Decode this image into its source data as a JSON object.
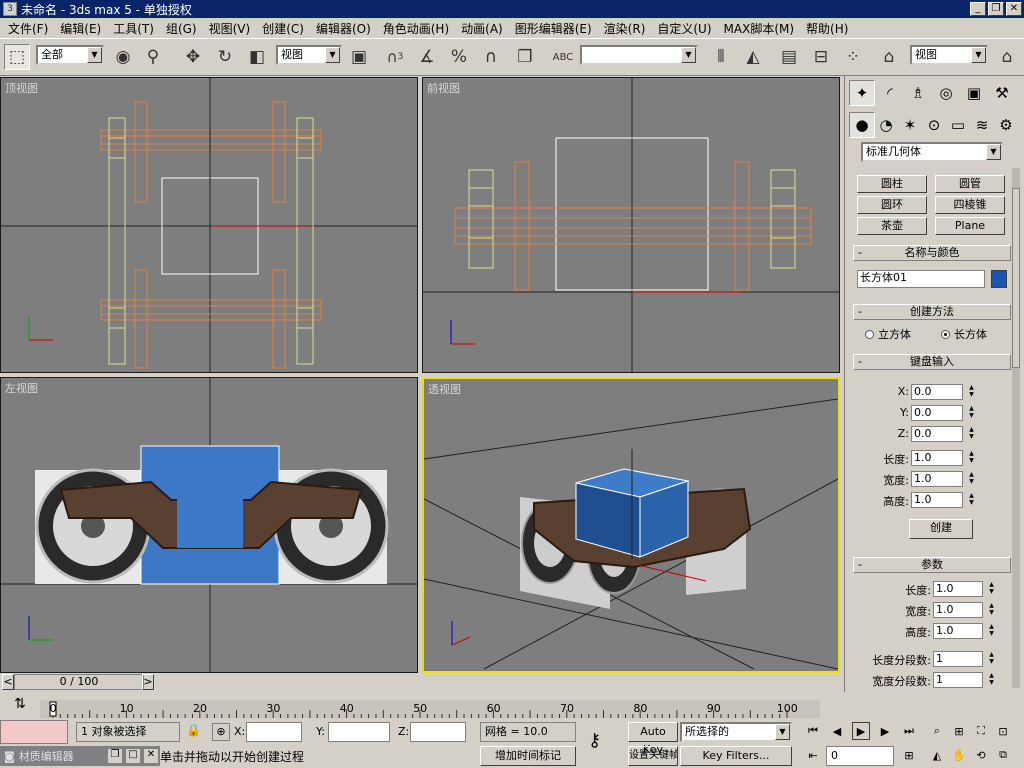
{
  "titlebar": {
    "icon": "3ds-max-icon",
    "title": "未命名 - 3ds max 5 - 单独授权",
    "minimize": "_",
    "restore": "❐",
    "close": "✕"
  },
  "menu": [
    "文件(F)",
    "编辑(E)",
    "工具(T)",
    "组(G)",
    "视图(V)",
    "创建(C)",
    "编辑器(O)",
    "角色动画(H)",
    "动画(A)",
    "图形编辑器(E)",
    "渲染(R)",
    "自定义(U)",
    "MAX脚本(M)",
    "帮助(H)"
  ],
  "toolbar": {
    "selection_filter": "全部",
    "coord_system": "视图",
    "named_selection": "",
    "view_dropdown_right": "视图",
    "selection_count_icon": "3"
  },
  "viewports": {
    "top": "顶视图",
    "front": "前视图",
    "left": "左视图",
    "perspective": "透视图"
  },
  "command_panel": {
    "category_dropdown": "标准几何体",
    "object_buttons": [
      "圆柱",
      "圆管",
      "圆环",
      "四棱锥",
      "茶壶",
      "Plane"
    ],
    "name_color": {
      "header": "名称与颜色",
      "name": "长方体01",
      "color": "#1c55b0"
    },
    "creation_method": {
      "header": "创建方法",
      "options": [
        "立方体",
        "长方体"
      ],
      "selected": "长方体"
    },
    "keyboard_entry": {
      "header": "键盘输入",
      "x_label": "X:",
      "x": "0.0",
      "y_label": "Y:",
      "y": "0.0",
      "z_label": "Z:",
      "z": "0.0",
      "length_label": "长度:",
      "length": "1.0",
      "width_label": "宽度:",
      "width": "1.0",
      "height_label": "高度:",
      "height": "1.0",
      "create_button": "创建"
    },
    "parameters": {
      "header": "参数",
      "length_label": "长度:",
      "length": "1.0",
      "width_label": "宽度:",
      "width": "1.0",
      "height_label": "高度:",
      "height": "1.0",
      "length_segs_label": "长度分段数:",
      "length_segs": "1",
      "width_segs_label": "宽度分段数:",
      "width_segs": "1",
      "height_segs_label": "高度分段数:",
      "height_segs": "1"
    }
  },
  "timeline": {
    "slider_text": "0 / 100",
    "prev": "<",
    "next": ">",
    "ticks": [
      "0",
      "10",
      "20",
      "30",
      "40",
      "50",
      "60",
      "70",
      "80",
      "90",
      "100"
    ]
  },
  "status": {
    "selection_text": "1 对象被选择",
    "prompt_text": "单击并拖动以开始创建过程",
    "x_label": "X:",
    "y_label": "Y:",
    "z_label": "Z:",
    "x_value": "",
    "y_value": "",
    "z_value": "",
    "grid": "网格 = 10.0",
    "add_time_tag": "增加时间标记",
    "auto_key": "Auto Key",
    "set_key": "设置关键帧",
    "key_mode_dropdown": "所选择的",
    "key_filters": "Key Filters...",
    "current_frame": "0"
  },
  "material_editor": {
    "title": "材质编辑器"
  },
  "colors": {
    "ui_gray": "#d4d0c8",
    "viewport_gray": "#7e7e7e",
    "active_viewport": "#f0e000",
    "selection_orange": "#e08040",
    "wheel_yellow": "#d8e090",
    "titlebar_blue": "#0a246a"
  }
}
